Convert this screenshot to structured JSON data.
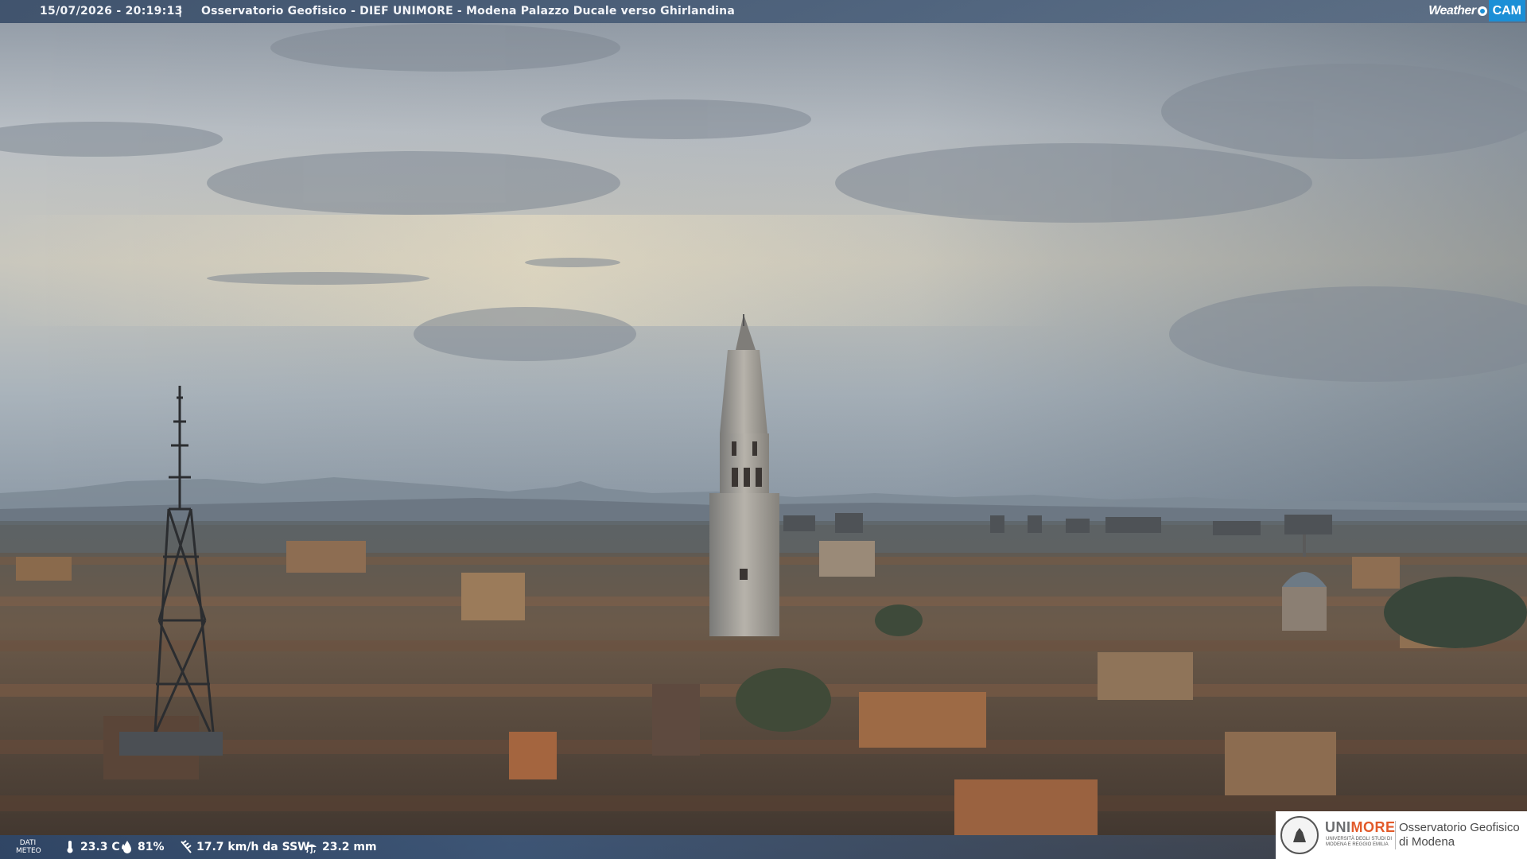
{
  "header": {
    "timestamp": "15/07/2026 - 20:19:13",
    "separator": "|",
    "location": "Osservatorio Geofisico - DIEF UNIMORE - Modena Palazzo Ducale verso Ghirlandina"
  },
  "logo": {
    "weather": "Weather",
    "cam": "CAM"
  },
  "weather_bar": {
    "label_line1": "DATI",
    "label_line2": "METEO",
    "temperature": "23.3 C",
    "humidity": "81%",
    "wind": "17.7 km/h da SSW",
    "rain": "23.2 mm",
    "icons": [
      "thermometer-icon",
      "humidity-drop-icon",
      "wind-icon",
      "rain-icon"
    ]
  },
  "institution": {
    "brand_first": "UNI",
    "brand_rest": "MORE",
    "subtitle": "UNIVERSITÀ DEGLI STUDI DI MODENA E REGGIO EMILIA",
    "name_line1": "Osservatorio Geofisico",
    "name_line2": "di Modena"
  },
  "colors": {
    "brand_orange": "#e25a2a",
    "weathercam_blue": "#1c8fd6",
    "bar_blue": "#3a5a85"
  }
}
